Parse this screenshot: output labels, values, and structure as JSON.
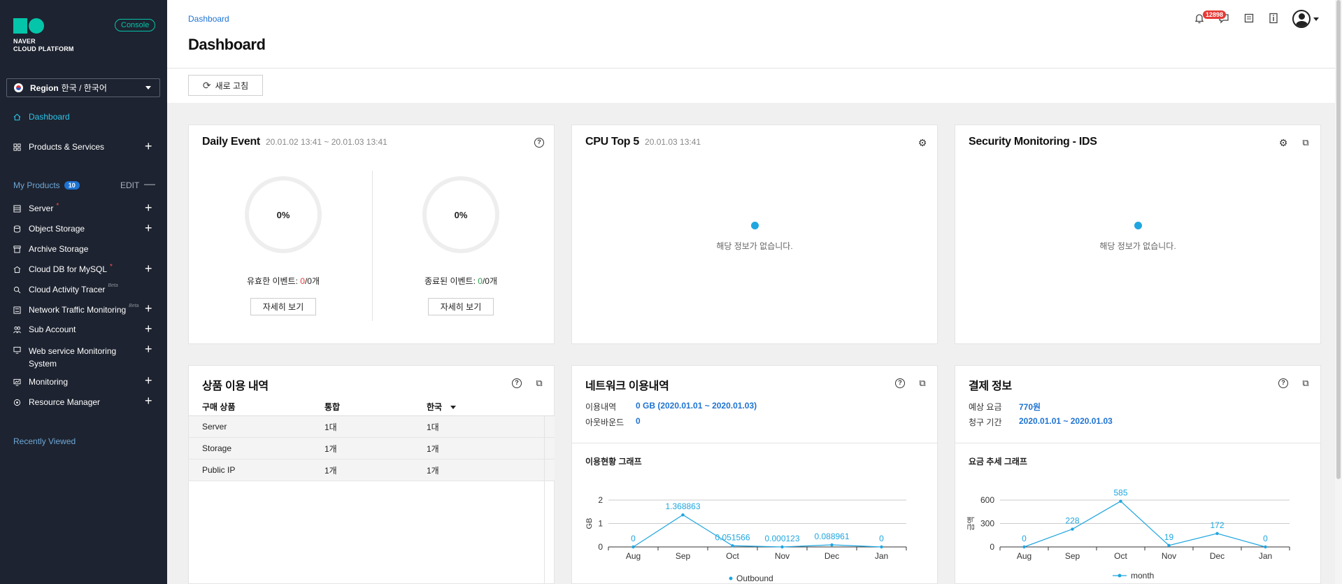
{
  "sidebar": {
    "logo_line1": "NAVER",
    "logo_line2": "CLOUD PLATFORM",
    "console_badge": "Console",
    "region_label": "Region",
    "region_value": "한국 / 한국어",
    "dashboard": "Dashboard",
    "products_services": "Products & Services",
    "my_products": "My Products",
    "my_products_count": "10",
    "edit": "EDIT",
    "items": [
      {
        "label": "Server",
        "required": "*"
      },
      {
        "label": "Object Storage"
      },
      {
        "label": "Archive Storage"
      },
      {
        "label": "Cloud DB for MySQL",
        "required": "*"
      },
      {
        "label": "Cloud Activity Tracer",
        "beta": "Beta"
      },
      {
        "label": "Network Traffic Monitoring",
        "beta": "Beta"
      },
      {
        "label": "Sub Account"
      },
      {
        "label": "Web service Monitoring",
        "label2": "System"
      },
      {
        "label": "Monitoring"
      },
      {
        "label": "Resource Manager"
      }
    ],
    "recently_viewed": "Recently Viewed"
  },
  "header": {
    "breadcrumb": "Dashboard",
    "title": "Dashboard",
    "refresh_label": "새로 고침",
    "notification_count": "12898"
  },
  "daily_event": {
    "title": "Daily Event",
    "range": "20.01.02 13:41 ~ 20.01.03 13:41",
    "valid": {
      "percent": "0%",
      "label": "유효한 이벤트: ",
      "current": "0",
      "sep": "/",
      "total": "0개",
      "button": "자세히 보기"
    },
    "ended": {
      "percent": "0%",
      "label": "종료된 이벤트: ",
      "current": "0",
      "sep": "/",
      "total": "0개",
      "button": "자세히 보기"
    }
  },
  "cpu_top5": {
    "title": "CPU Top 5",
    "time": "20.01.03 13:41",
    "empty": "해당 정보가 없습니다."
  },
  "security": {
    "title": "Security Monitoring - IDS",
    "empty": "해당 정보가 없습니다."
  },
  "product_usage": {
    "title": "상품 이용 내역",
    "headers": [
      "구매 상품",
      "통합",
      "한국"
    ],
    "rows": [
      [
        "Server",
        "1대",
        "1대"
      ],
      [
        "Storage",
        "1개",
        "1개"
      ],
      [
        "Public IP",
        "1개",
        "1개"
      ]
    ]
  },
  "network_usage": {
    "title": "네트워크 이용내역",
    "usage_label": "이용내역",
    "usage_value": "0 GB (2020.01.01 ~ 2020.01.03)",
    "outbound_label": "아웃바운드",
    "outbound_value": "0",
    "graph_title": "이용현황 그래프"
  },
  "billing": {
    "title": "결제 정보",
    "expected_label": "예상 요금",
    "expected_value": "770원",
    "period_label": "청구 기간",
    "period_value": "2020.01.01 ~ 2020.01.03",
    "graph_title": "요금 추세 그래프"
  },
  "chart_data": [
    {
      "type": "line",
      "categories": [
        "Aug",
        "Sep",
        "Oct",
        "Nov",
        "Dec",
        "Jan"
      ],
      "series": [
        {
          "name": "Outbound",
          "values": [
            0,
            1.368863,
            0.051566,
            0.000123,
            0.088961,
            0
          ],
          "labels": [
            "0",
            "1.368863",
            "0.051566",
            "0.000123",
            "0.088961",
            "0"
          ]
        }
      ],
      "ylabel": "GB",
      "yticks": [
        0,
        1,
        2
      ],
      "ylim": [
        0,
        2
      ],
      "color": "#1fa6e0",
      "legend": "bottom-center",
      "grid": true
    },
    {
      "type": "line",
      "categories": [
        "Aug",
        "Sep",
        "Oct",
        "Nov",
        "Dec",
        "Jan"
      ],
      "series": [
        {
          "name": "month",
          "values": [
            0,
            228,
            585,
            19,
            172,
            0
          ],
          "labels": [
            "0",
            "228",
            "585",
            "19",
            "172",
            "0"
          ]
        }
      ],
      "ylabel": "금액",
      "yticks": [
        0,
        300,
        600
      ],
      "ylim": [
        0,
        600
      ],
      "color": "#1fa6e0",
      "legend": "bottom-center",
      "grid": true
    }
  ]
}
